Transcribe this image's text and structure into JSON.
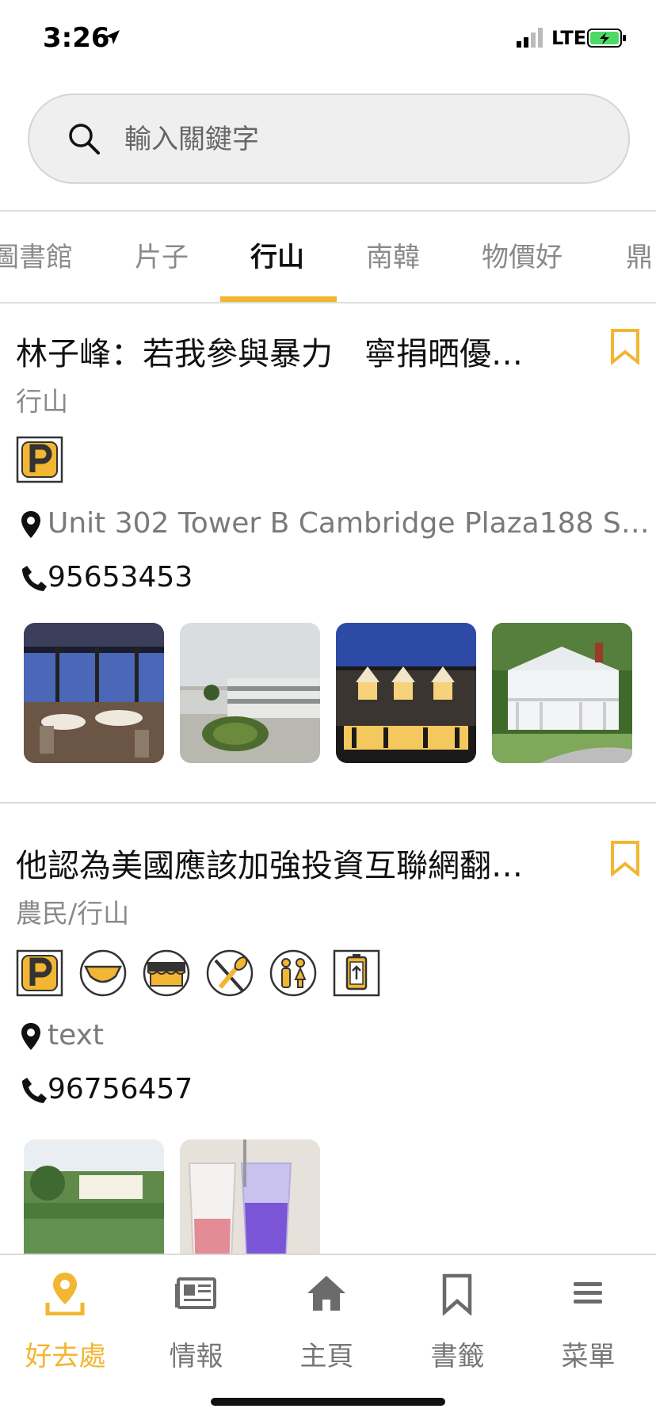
{
  "status": {
    "time": "3:26",
    "network": "LTE"
  },
  "search": {
    "placeholder": "輸入關鍵字"
  },
  "tabs": [
    {
      "label": "圖書館"
    },
    {
      "label": "片子"
    },
    {
      "label": "行山",
      "active": true
    },
    {
      "label": "南韓"
    },
    {
      "label": "物價好"
    },
    {
      "label": "鼎"
    }
  ],
  "cards": [
    {
      "title": "林子峰：若我參與暴力　寧捐晒優…",
      "category": "行山",
      "amenities": [
        "parking-icon"
      ],
      "address": "Unit 302 Tower B Cambridge Plaza188 S…",
      "phone": "95653453",
      "images": [
        "restaurant-interior",
        "campus-building",
        "lit-house-night",
        "white-mansion"
      ]
    },
    {
      "title": "他認為美國應該加強投資互聯網翻…",
      "category": "農民/行山",
      "amenities": [
        "parking-icon",
        "diaper-icon",
        "shop-icon",
        "restaurant-icon",
        "restroom-icon",
        "charging-icon"
      ],
      "address": "text",
      "phone": "96756457",
      "images": [
        "lake-mansion",
        "drinks-glasses"
      ]
    }
  ],
  "tabbar": [
    {
      "label": "好去處",
      "icon": "location-icon",
      "active": true
    },
    {
      "label": "情報",
      "icon": "news-icon"
    },
    {
      "label": "主頁",
      "icon": "home-icon"
    },
    {
      "label": "書籤",
      "icon": "bookmark-icon"
    },
    {
      "label": "菜單",
      "icon": "menu-icon"
    }
  ],
  "colors": {
    "accent": "#f2b632",
    "muted": "#8a8a8a"
  }
}
